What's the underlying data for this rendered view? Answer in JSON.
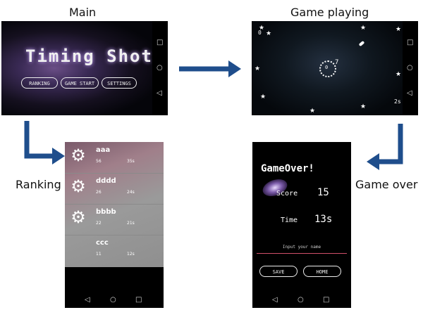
{
  "captions": {
    "main": "Main",
    "game_playing": "Game playing",
    "ranking": "Ranking",
    "game_over": "Game over"
  },
  "main_screen": {
    "title": "Timing Shot",
    "buttons": [
      "RANKING",
      "GAME START",
      "SETTINGS"
    ]
  },
  "game_screen": {
    "score": "0",
    "timer": "2s",
    "center_number": "0",
    "center_superscript": "7"
  },
  "ranking_screen": {
    "rows": [
      {
        "name": "aaa",
        "score": "56",
        "time": "35s",
        "has_icon": true
      },
      {
        "name": "dddd",
        "score": "26",
        "time": "24s",
        "has_icon": true
      },
      {
        "name": "bbbb",
        "score": "22",
        "time": "21s",
        "has_icon": true
      },
      {
        "name": "ccc",
        "score": "11",
        "time": "12s",
        "has_icon": false
      }
    ]
  },
  "gameover_screen": {
    "title": "GameOver!",
    "score_label": "Score",
    "score_value": "15",
    "time_label": "Time",
    "time_value": "13s",
    "input_placeholder": "Input your name",
    "save_label": "SAVE",
    "home_label": "HOME"
  },
  "nav": {
    "back": "◁",
    "home": "○",
    "recent": "□"
  },
  "colors": {
    "arrow": "#1f4e8c",
    "input_underline": "#d0506a"
  }
}
